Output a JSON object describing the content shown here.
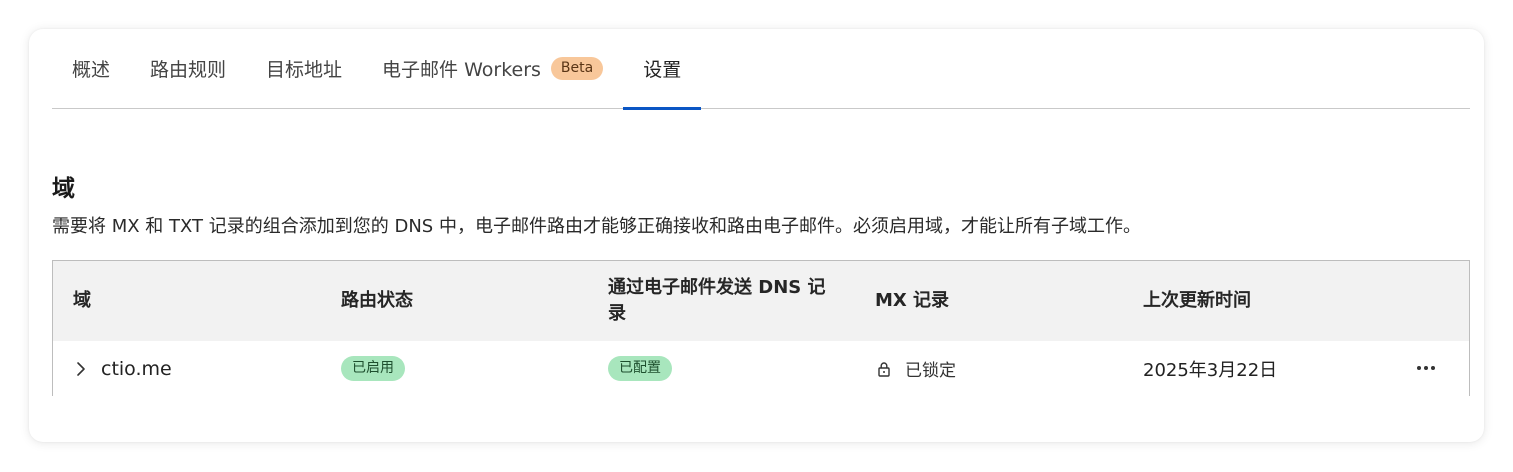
{
  "tabs": [
    {
      "label": "概述"
    },
    {
      "label": "路由规则"
    },
    {
      "label": "目标地址"
    },
    {
      "label": "电子邮件 Workers",
      "badge": "Beta"
    },
    {
      "label": "设置",
      "active": true
    }
  ],
  "section": {
    "title": "域",
    "description": "需要将 MX 和 TXT 记录的组合添加到您的 DNS 中，电子邮件路由才能够正确接收和路由电子邮件。必须启用域，才能让所有子域工作。"
  },
  "table": {
    "columns": [
      "域",
      "路由状态",
      "通过电子邮件发送 DNS 记录",
      "MX 记录",
      "上次更新时间"
    ],
    "rows": [
      {
        "domain": "ctio.me",
        "routing_status": "已启用",
        "dns_records": "已配置",
        "mx_records": "已锁定",
        "last_updated": "2025年3月22日"
      }
    ]
  },
  "colors": {
    "active_tab": "#0b56c4",
    "beta_badge": "#f8c79a",
    "status_pill": "#a8e6bd",
    "header_bg": "#f2f2f2"
  },
  "icons": {
    "row_expand": "chevron-right-icon",
    "mx_lock": "lock-icon",
    "row_actions": "more-horizontal-icon"
  }
}
